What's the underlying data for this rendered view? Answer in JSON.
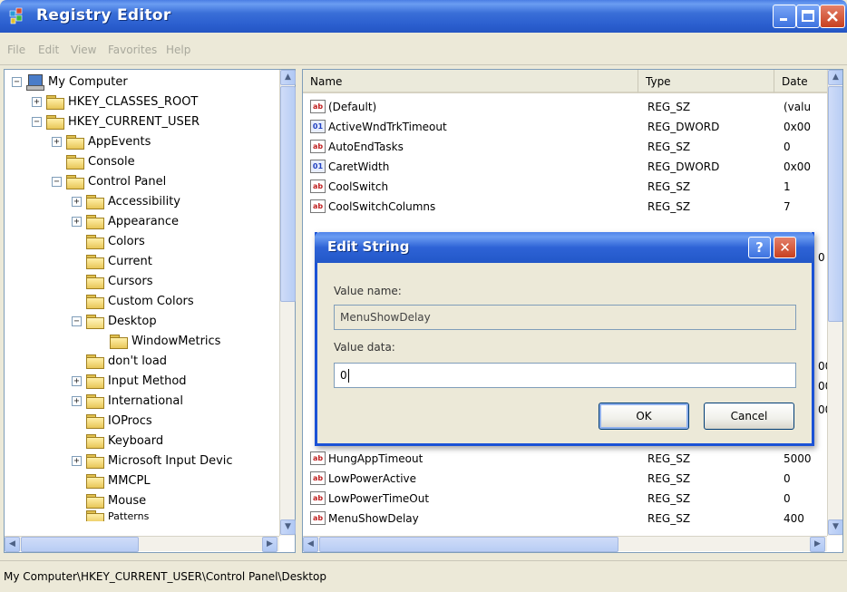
{
  "window": {
    "title": "Registry Editor",
    "icon": "registry-editor-icon"
  },
  "menu": [
    "File",
    "Edit",
    "View",
    "Favorites",
    "Help"
  ],
  "tree": {
    "items": [
      {
        "label": "My Computer",
        "expander": "−",
        "icon": "computer-icon"
      },
      {
        "label": "HKEY_CLASSES_ROOT",
        "expander": "+",
        "icon": "folder-icon"
      },
      {
        "label": "HKEY_CURRENT_USER",
        "expander": "−",
        "icon": "folder-icon"
      },
      {
        "label": "AppEvents",
        "expander": "+",
        "icon": "folder-icon"
      },
      {
        "label": "Console",
        "expander": "",
        "icon": "folder-icon"
      },
      {
        "label": "Control Panel",
        "expander": "−",
        "icon": "folder-icon"
      },
      {
        "label": "Accessibility",
        "expander": "+",
        "icon": "folder-icon"
      },
      {
        "label": "Appearance",
        "expander": "+",
        "icon": "folder-icon"
      },
      {
        "label": "Colors",
        "expander": "",
        "icon": "folder-icon"
      },
      {
        "label": "Current",
        "expander": "",
        "icon": "folder-icon"
      },
      {
        "label": "Cursors",
        "expander": "",
        "icon": "folder-icon"
      },
      {
        "label": "Custom Colors",
        "expander": "",
        "icon": "folder-icon"
      },
      {
        "label": "Desktop",
        "expander": "−",
        "icon": "open-folder-icon"
      },
      {
        "label": "WindowMetrics",
        "expander": "",
        "icon": "folder-icon"
      },
      {
        "label": "don't load",
        "expander": "",
        "icon": "folder-icon"
      },
      {
        "label": "Input Method",
        "expander": "+",
        "icon": "folder-icon"
      },
      {
        "label": "International",
        "expander": "+",
        "icon": "folder-icon"
      },
      {
        "label": "IOProcs",
        "expander": "",
        "icon": "folder-icon"
      },
      {
        "label": "Keyboard",
        "expander": "",
        "icon": "folder-icon"
      },
      {
        "label": "Microsoft Input Devic",
        "expander": "+",
        "icon": "folder-icon"
      },
      {
        "label": "MMCPL",
        "expander": "",
        "icon": "folder-icon"
      },
      {
        "label": "Mouse",
        "expander": "",
        "icon": "folder-icon"
      },
      {
        "label": "Patterns",
        "expander": "",
        "icon": "folder-icon"
      }
    ]
  },
  "list": {
    "columns": [
      "Name",
      "Type",
      "Data"
    ],
    "column_data_truncated": "Date",
    "rows": [
      {
        "name": "(Default)",
        "type": "REG_SZ",
        "data": "(valu",
        "kind": "sz"
      },
      {
        "name": "ActiveWndTrkTimeout",
        "type": "REG_DWORD",
        "data": "0x00",
        "kind": "dw"
      },
      {
        "name": "AutoEndTasks",
        "type": "REG_SZ",
        "data": "0",
        "kind": "sz"
      },
      {
        "name": "CaretWidth",
        "type": "REG_DWORD",
        "data": "0x00",
        "kind": "dw"
      },
      {
        "name": "CoolSwitch",
        "type": "REG_SZ",
        "data": "1",
        "kind": "sz"
      },
      {
        "name": "CoolSwitchColumns",
        "type": "REG_SZ",
        "data": "7",
        "kind": "sz"
      },
      {
        "name": "HungAppTimeout",
        "type": "REG_SZ",
        "data": "5000",
        "kind": "sz"
      },
      {
        "name": "LowPowerActive",
        "type": "REG_SZ",
        "data": "0",
        "kind": "sz"
      },
      {
        "name": "LowPowerTimeOut",
        "type": "REG_SZ",
        "data": "0",
        "kind": "sz"
      },
      {
        "name": "MenuShowDelay",
        "type": "REG_SZ",
        "data": "400",
        "kind": "sz"
      }
    ],
    "hidden_data_peek": [
      "0",
      "00",
      "00",
      "00"
    ]
  },
  "dialog": {
    "title": "Edit String",
    "help_label": "?",
    "close_label": "✕",
    "value_name_label": "Value name:",
    "value_name": "MenuShowDelay",
    "value_data_label": "Value data:",
    "value_data": "0",
    "ok_label": "OK",
    "cancel_label": "Cancel"
  },
  "status": {
    "path": "My Computer\\HKEY_CURRENT_USER\\Control Panel\\Desktop"
  },
  "colors": {
    "titlebar": "#2b5fcf",
    "window_bg": "#ece9d8",
    "dialog_border": "#1b52d6"
  }
}
